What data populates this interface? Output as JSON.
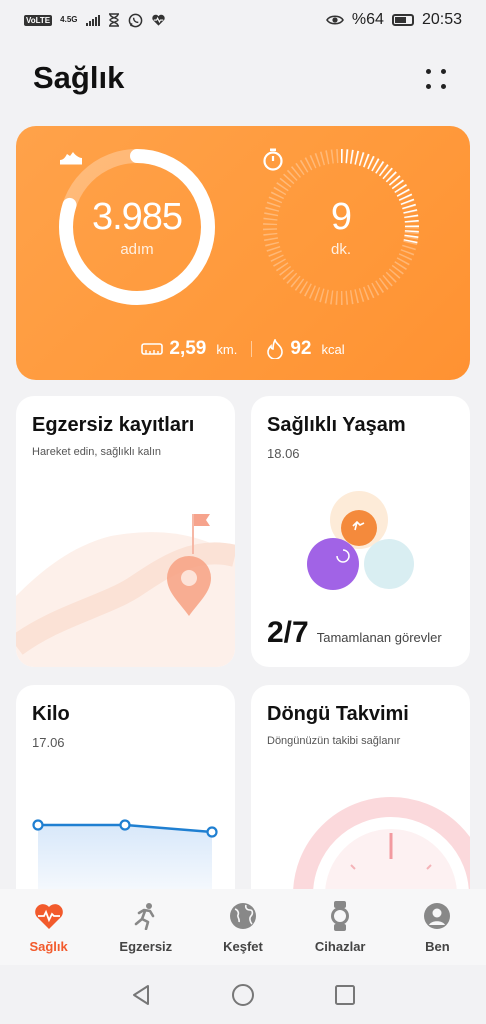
{
  "status_bar": {
    "volte": "VoLTE",
    "network": "4.5G",
    "battery": "%64",
    "time": "20:53"
  },
  "header": {
    "title": "Sağlık"
  },
  "summary": {
    "steps_value": "3.985",
    "steps_label": "adım",
    "steps_progress": 0.8,
    "minutes_value": "9",
    "minutes_label": "dk.",
    "minutes_progress": 0.3,
    "distance_value": "2,59",
    "distance_unit": "km.",
    "calories_value": "92",
    "calories_unit": "kcal"
  },
  "cards": {
    "exercise": {
      "title": "Egzersiz kayıtları",
      "subtitle": "Hareket edin, sağlıklı kalın"
    },
    "healthy_living": {
      "title": "Sağlıklı Yaşam",
      "date": "18.06",
      "tasks_count": "2/7",
      "tasks_label": "Tamamlanan görevler"
    },
    "weight": {
      "title": "Kilo",
      "date": "17.06"
    },
    "cycle": {
      "title": "Döngü Takvimi",
      "subtitle": "Döngünüzün takibi sağlanır"
    }
  },
  "nav": {
    "items": [
      {
        "label": "Sağlık",
        "icon": "heart-pulse-icon",
        "active": true
      },
      {
        "label": "Egzersiz",
        "icon": "running-icon",
        "active": false
      },
      {
        "label": "Keşfet",
        "icon": "globe-icon",
        "active": false
      },
      {
        "label": "Cihazlar",
        "icon": "watch-icon",
        "active": false
      },
      {
        "label": "Ben",
        "icon": "person-icon",
        "active": false
      }
    ]
  },
  "colors": {
    "accent": "#f25a2c",
    "card_orange": "#ff9a3c",
    "weight_line": "#1f7fd1"
  }
}
